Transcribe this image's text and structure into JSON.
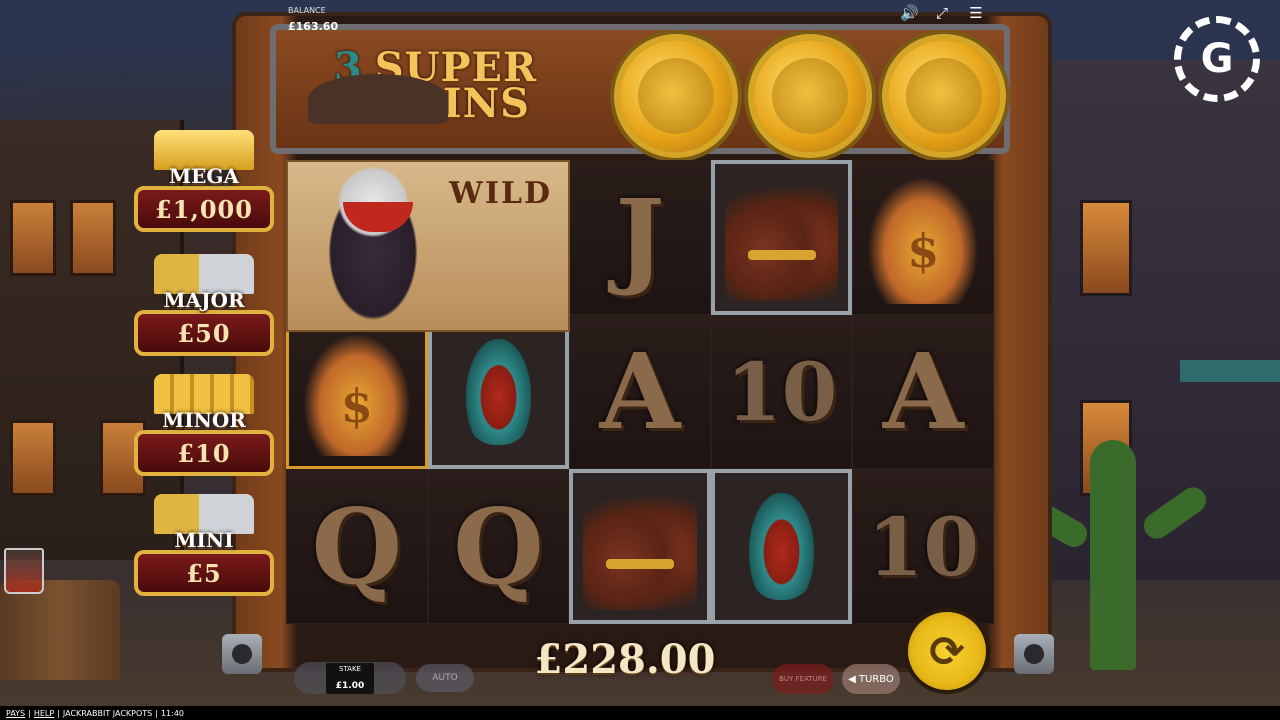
{
  "balance": {
    "label": "BALANCE",
    "value": "£163.60"
  },
  "top_icons": [
    "speaker-icon",
    "fullscreen-icon",
    "menu-icon"
  ],
  "logo": {
    "letter": "G"
  },
  "feature": {
    "count": "3",
    "title_line1": "SUPER",
    "title_line2": "SPINS"
  },
  "wild_label": "WILD",
  "jackpots": [
    {
      "name": "MEGA",
      "amount": "£1,000"
    },
    {
      "name": "MAJOR",
      "amount": "£50"
    },
    {
      "name": "MINOR",
      "amount": "£10"
    },
    {
      "name": "MINI",
      "amount": "£5"
    }
  ],
  "reels": {
    "row1": [
      "wild",
      "wild",
      "J",
      "boots",
      "bag"
    ],
    "row2": [
      "bag",
      "flask",
      "A",
      "10",
      "A"
    ],
    "row3": [
      "Q",
      "Q",
      "boots",
      "flask",
      "10"
    ]
  },
  "win_amount": "£228.00",
  "controls": {
    "stake_label": "STAKE",
    "stake_value": "£1.00",
    "auto_label": "AUTO",
    "buy_feature_label": "BUY FEATURE",
    "turbo_label": "TURBO"
  },
  "footer": {
    "pays": "PAYS",
    "help": "HELP",
    "game_name": "JACKRABBIT JACKPOTS",
    "time": "11:40"
  }
}
